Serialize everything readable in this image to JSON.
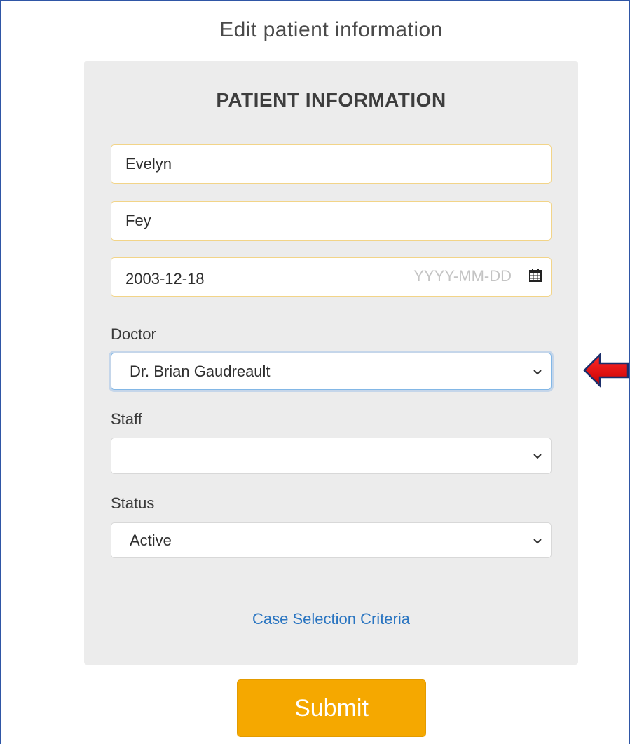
{
  "page": {
    "title": "Edit patient information"
  },
  "form": {
    "heading": "PATIENT INFORMATION",
    "first_name": "Evelyn",
    "last_name": "Fey",
    "date_of_birth": "2003-12-18",
    "date_placeholder": "YYYY-MM-DD",
    "doctor_label": "Doctor",
    "doctor_value": "Dr. Brian Gaudreault",
    "staff_label": "Staff",
    "staff_value": "",
    "status_label": "Status",
    "status_value": "Active",
    "case_link": "Case Selection Criteria",
    "submit_label": "Submit"
  },
  "icons": {
    "calendar": "calendar-icon",
    "chevron": "chevron-down-icon",
    "annotation": "red-arrow-left-icon"
  },
  "colors": {
    "accent": "#f5a800",
    "link": "#2a75c1",
    "annotation": "#e00000",
    "focus": "#82b7e6"
  }
}
